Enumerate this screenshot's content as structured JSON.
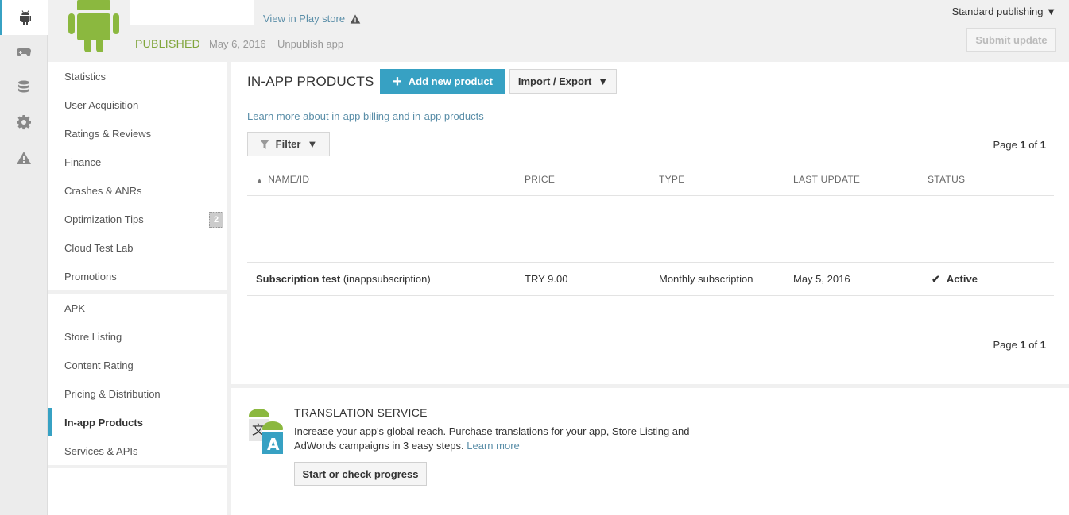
{
  "header": {
    "view_store": "View in Play store",
    "published": "PUBLISHED",
    "published_date": "May 6, 2016",
    "unpublish": "Unpublish app",
    "publishing_mode": "Standard publishing ▼",
    "submit_update": "Submit update"
  },
  "rail": {
    "icons": [
      "android-icon",
      "gamepad-icon",
      "database-icon",
      "gear-icon",
      "warning-icon"
    ]
  },
  "nav": {
    "group1": [
      {
        "label": "Statistics"
      },
      {
        "label": "User Acquisition"
      },
      {
        "label": "Ratings & Reviews"
      },
      {
        "label": "Finance"
      },
      {
        "label": "Crashes & ANRs"
      },
      {
        "label": "Optimization Tips",
        "badge": "2"
      },
      {
        "label": "Cloud Test Lab"
      },
      {
        "label": "Promotions"
      }
    ],
    "group2": [
      {
        "label": "APK"
      },
      {
        "label": "Store Listing"
      },
      {
        "label": "Content Rating"
      },
      {
        "label": "Pricing & Distribution"
      },
      {
        "label": "In-app Products"
      },
      {
        "label": "Services & APIs"
      }
    ]
  },
  "main": {
    "title": "IN-APP PRODUCTS",
    "add_button": "Add new product",
    "import_export": "Import / Export",
    "learn_more": "Learn more about in-app billing and in-app products",
    "filter": "Filter",
    "page_prefix": "Page",
    "page_current": "1",
    "page_of": "of",
    "page_total": "1",
    "columns": [
      "NAME/ID",
      "PRICE",
      "TYPE",
      "LAST UPDATE",
      "STATUS"
    ],
    "rows": [
      {
        "name": "Subscription test",
        "id": "(inappsubscription)",
        "price": "TRY 9.00",
        "type": "Monthly subscription",
        "last_update": "May 5, 2016",
        "status": "Active"
      }
    ]
  },
  "translation": {
    "title": "TRANSLATION SERVICE",
    "description": "Increase your app's global reach. Purchase translations for your app, Store Listing and AdWords campaigns in 3 easy steps.",
    "learn_more": "Learn more",
    "button": "Start or check progress"
  },
  "colors": {
    "accent": "#37a1c3",
    "published_green": "#80a53b",
    "link": "#5a8ea8"
  }
}
